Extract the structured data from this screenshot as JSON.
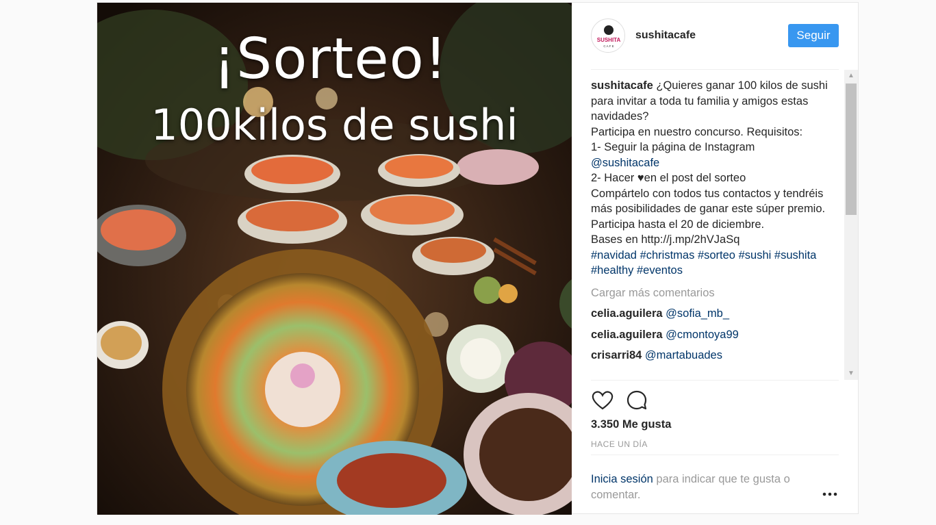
{
  "image": {
    "headline_line1": "¡Sorteo!",
    "headline_line2": "100kilos de sushi"
  },
  "header": {
    "avatar_logo": "SUSHITA CAFE",
    "username": "sushitacafe",
    "follow_label": "Seguir",
    "follow_color": "#3897f0"
  },
  "caption": {
    "username": "sushitacafe",
    "text1": "¿Quieres ganar 100 kilos de sushi para invitar a toda tu familia y amigos estas navidades?\nParticipa en nuestro concurso. Requisitos:\n1- Seguir la página de Instagram\n",
    "mention": "@sushitacafe",
    "text2": "\n2- Hacer ♥en el post del sorteo\nCompártelo con todos tus contactos y tendréis más posibilidades de ganar este súper premio.\nParticipa hasta el 20 de diciembre.\nBases en http://j.mp/2hVJaSq\n",
    "hashtags": [
      "#navidad",
      "#christmas",
      "#sorteo",
      "#sushi",
      "#sushita",
      "#healthy",
      "#eventos"
    ]
  },
  "load_more": "Cargar más comentarios",
  "comments": [
    {
      "user": "celia.aguilera",
      "text": "@sofia_mb_"
    },
    {
      "user": "celia.aguilera",
      "text": "@cmontoya99"
    },
    {
      "user": "crisarri84",
      "text": "@martabuades"
    }
  ],
  "actions": {
    "like_icon": "heart-icon",
    "comment_icon": "comment-icon"
  },
  "likes": "3.350 Me gusta",
  "time": "HACE UN DÍA",
  "login": {
    "link": "Inicia sesión",
    "text": " para indicar que te gusta o comentar."
  },
  "link_color": "#003569"
}
